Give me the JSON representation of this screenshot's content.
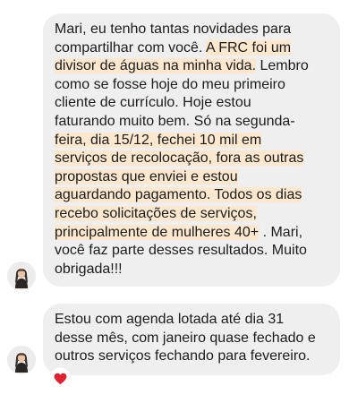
{
  "messages": [
    {
      "lines": [
        {
          "parts": [
            {
              "text": "Mari, eu tenho tantas novidades para",
              "hl": false
            }
          ]
        },
        {
          "parts": [
            {
              "text": "compartilhar com você. ",
              "hl": false
            },
            {
              "text": " A FRC foi um",
              "hl": true
            }
          ]
        },
        {
          "parts": [
            {
              "text": "divisor de águas na minha vida.",
              "hl": true
            },
            {
              "text": " Lembro",
              "hl": false
            }
          ]
        },
        {
          "parts": [
            {
              "text": "como se fosse hoje do  meu primeiro",
              "hl": false
            }
          ]
        },
        {
          "parts": [
            {
              "text": "cliente de currículo. Hoje estou",
              "hl": false
            }
          ]
        },
        {
          "parts": [
            {
              "text": "faturando  muito bem.  Só na segunda-",
              "hl": false
            }
          ]
        },
        {
          "parts": [
            {
              "text": "feira,  dia 15/12, fechei 10 mil em",
              "hl": true
            }
          ]
        },
        {
          "parts": [
            {
              "text": "serviços de recolocação, fora as outras",
              "hl": true
            }
          ]
        },
        {
          "parts": [
            {
              "text": "propostas que enviei e estou",
              "hl": true
            }
          ]
        },
        {
          "parts": [
            {
              "text": "aguardando pagamento.  Todos os dias",
              "hl": true
            }
          ]
        },
        {
          "parts": [
            {
              "text": "recebo solicitações de serviços,",
              "hl": true
            }
          ]
        },
        {
          "parts": [
            {
              "text": "principalmente de mulheres  40+",
              "hl": true
            },
            {
              "text": " . Mari,",
              "hl": false
            }
          ]
        },
        {
          "parts": [
            {
              "text": "você  faz parte desses resultados.  Muito",
              "hl": false
            }
          ]
        },
        {
          "parts": [
            {
              "text": "obrigada!!!",
              "hl": false
            }
          ]
        }
      ]
    },
    {
      "lines": [
        {
          "parts": [
            {
              "text": "Estou com agenda lotada até dia 31",
              "hl": false
            }
          ]
        },
        {
          "parts": [
            {
              "text": "desse mês, com janeiro quase fechado e",
              "hl": false
            }
          ]
        },
        {
          "parts": [
            {
              "text": "outros serviços fechando para fevereiro.",
              "hl": false
            }
          ]
        }
      ]
    }
  ],
  "reaction": {
    "icon": "red-heart-icon",
    "color": "#e0212f"
  },
  "colors": {
    "bubble": "#efefef",
    "highlight": "#fbe8cf",
    "text": "#1c1c1c"
  }
}
